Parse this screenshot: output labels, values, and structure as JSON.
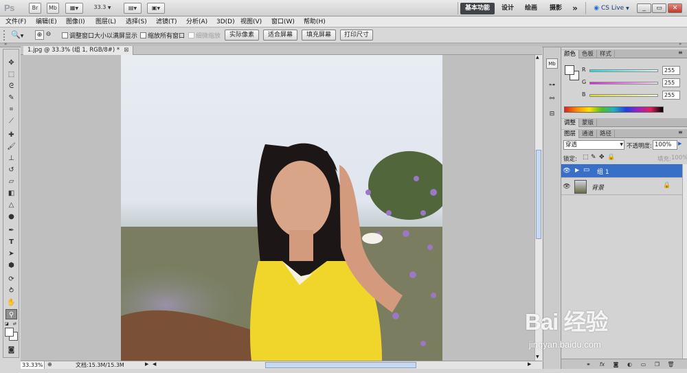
{
  "app": {
    "logo": "Ps",
    "bridge_label": "Br",
    "minibridge_label": "Mb",
    "zoom_value": "33.3",
    "workspaces": [
      "基本功能",
      "设计",
      "绘画",
      "摄影"
    ],
    "more_label": "»",
    "cslive_label": "CS Live",
    "window_controls": [
      "_",
      "▭",
      "✕"
    ]
  },
  "menu": [
    "文件(F)",
    "编辑(E)",
    "图像(I)",
    "图层(L)",
    "选择(S)",
    "滤镜(T)",
    "分析(A)",
    "3D(D)",
    "视图(V)",
    "窗口(W)",
    "帮助(H)"
  ],
  "options": {
    "resize_windows": "调整窗口大小以满屏显示",
    "zoom_all_windows": "缩放所有窗口",
    "scrubby_zoom": "细微缩放",
    "actual_pixels": "实际像素",
    "fit_screen": "适合屏幕",
    "fill_screen": "填充屏幕",
    "print_size": "打印尺寸"
  },
  "document": {
    "tab_title": "1.jpg @ 33.3% (组 1, RGB/8#) *",
    "zoom_status": "33.33%",
    "doc_size": "文档:15.3M/15.3M"
  },
  "color_panel": {
    "tabs": [
      "颜色",
      "色板",
      "样式"
    ],
    "channels": [
      {
        "label": "R",
        "value": "255",
        "color": "#20e0e0"
      },
      {
        "label": "G",
        "value": "255",
        "color": "#e020e0"
      },
      {
        "label": "B",
        "value": "255",
        "color": "#e0e020"
      }
    ]
  },
  "adjust_panel": {
    "tabs": [
      "调整",
      "蒙版"
    ]
  },
  "layers_panel": {
    "tabs": [
      "图层",
      "通道",
      "路径"
    ],
    "blend_mode": "穿透",
    "opacity_label": "不透明度:",
    "opacity_value": "100%",
    "lock_label": "锁定:",
    "fill_label": "填充:",
    "fill_value": "100%",
    "layers": [
      {
        "name": "组 1",
        "selected": true
      },
      {
        "name": "背景",
        "locked": true
      }
    ]
  },
  "watermark": {
    "brand": "Bai 经验",
    "url": "jingyan.baidu.com"
  }
}
